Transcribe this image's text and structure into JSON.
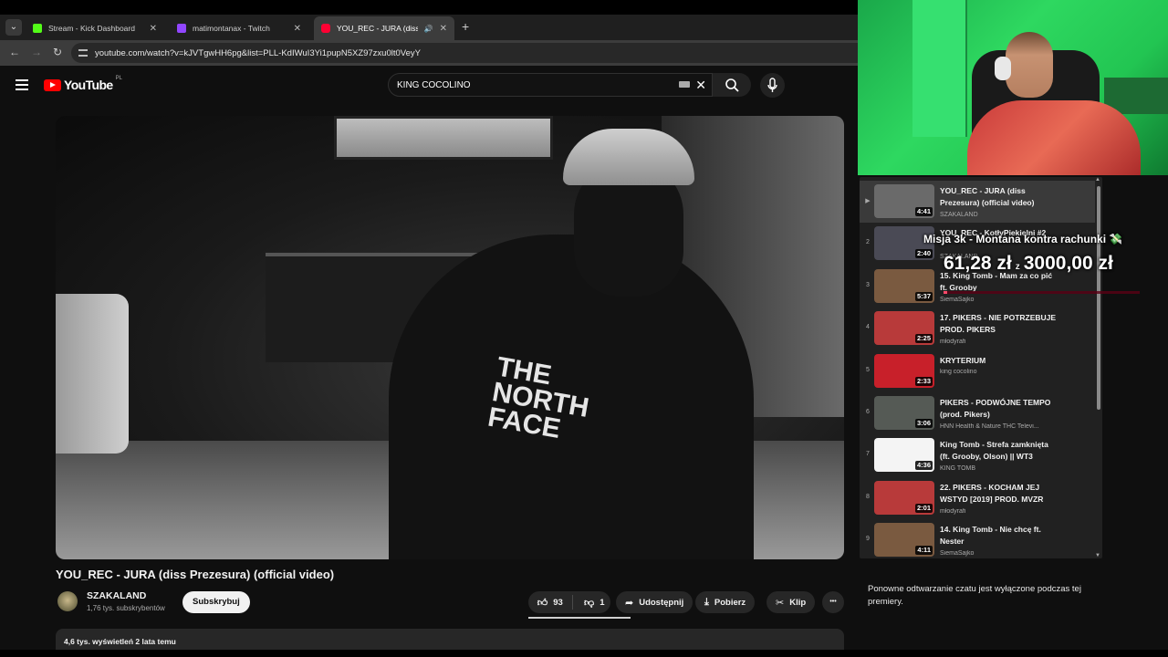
{
  "browser": {
    "tabs": [
      {
        "title": "Stream - Kick Dashboard",
        "color": "#53fc18"
      },
      {
        "title": "matimontanax - Twitch",
        "color": "#9146ff"
      },
      {
        "title": "YOU_REC - JURA (diss Prezesura) (official video)",
        "color": "#ff0033"
      }
    ],
    "new_tab": "+",
    "url": "youtube.com/watch?v=kJVTgwHH6pg&list=PLL-KdIWuI3Yi1pupN5XZ97zxu0lt0VeyY"
  },
  "youtube": {
    "logo_text": "YouTube",
    "country": "PL",
    "search_value": "KING COCOLINO"
  },
  "video": {
    "title": "YOU_REC - JURA (diss Prezesura) (official video)",
    "overlay_text": "THE\nNORTH\nFACE",
    "channel": "SZAKALAND",
    "subs": "1,76 tys. subskrybentów",
    "subscribe": "Subskrybuj",
    "likes": "93",
    "dislikes": "1",
    "share": "Udostępnij",
    "download": "Pobierz",
    "clip": "Klip",
    "more": "•••",
    "views_date": "4,6 tys. wyświetleń  2 lata temu"
  },
  "playlist": [
    {
      "index": "▶",
      "title": "YOU_REC - JURA (diss Prezesura) (official video)",
      "channel": "SZAKALAND",
      "duration": "4:41",
      "thumb": "#6a6a6a"
    },
    {
      "index": "2",
      "title": "YOU_REC - KotłyPiekielni #2",
      "channel": "SZAKALAND",
      "duration": "2:40",
      "thumb": "#4a4a55"
    },
    {
      "index": "3",
      "title": "15. King Tomb - Mam za co pić ft. Grooby",
      "channel": "SiemaSajko",
      "duration": "5:37",
      "thumb": "#7a5a40"
    },
    {
      "index": "4",
      "title": "17. PIKERS - NIE POTRZEBUJE PROD. PIKERS",
      "channel": "młodyrafi",
      "duration": "2:25",
      "thumb": "#b83a3a"
    },
    {
      "index": "5",
      "title": "KRYTERIUM",
      "channel": "king cocolino",
      "duration": "2:33",
      "thumb": "#c8202a"
    },
    {
      "index": "6",
      "title": "PIKERS - PODWÓJNE TEMPO (prod. Pikers)",
      "channel": "HNN Health & Nature THC Televi...",
      "duration": "3:06",
      "thumb": "#555a55"
    },
    {
      "index": "7",
      "title": "King Tomb - Strefa zamknięta (ft. Grooby, Olson) || WT3",
      "channel": "KING TOMB",
      "duration": "4:36",
      "thumb": "#f4f4f4"
    },
    {
      "index": "8",
      "title": "22. PIKERS - KOCHAM JEJ WSTYD [2019] PROD. MVZR",
      "channel": "młodyrafi",
      "duration": "2:01",
      "thumb": "#b83a3a"
    },
    {
      "index": "9",
      "title": "14. King Tomb - Nie chcę ft. Nester",
      "channel": "SiemaSajko",
      "duration": "4:11",
      "thumb": "#7a5a40"
    }
  ],
  "goal": {
    "title": "Misja 3k - Montana kontra rachunki 💸",
    "current": "61,28 zł",
    "separator": "z",
    "target": "3000,00 zł",
    "progress": 0.02
  },
  "chat_note": "Ponowne odtwarzanie czatu jest wyłączone podczas tej premiery."
}
